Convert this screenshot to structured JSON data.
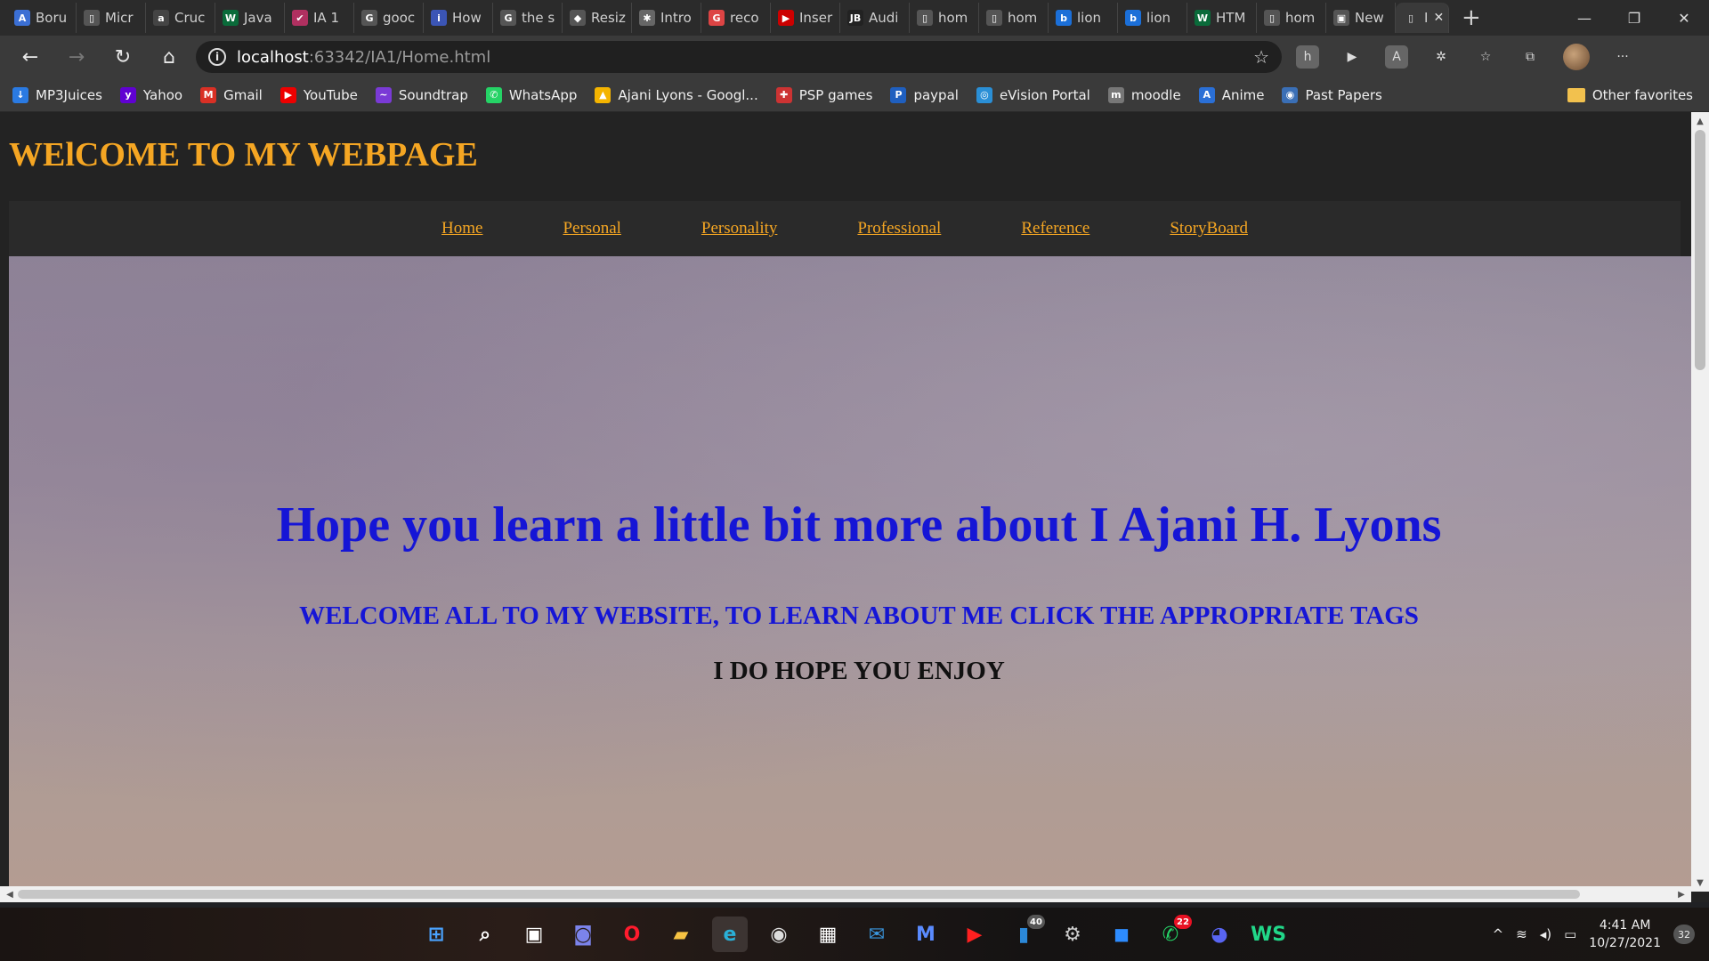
{
  "browser": {
    "tabs": [
      {
        "title": "Boru",
        "icon": "A",
        "icon_color": "#3b6fd4"
      },
      {
        "title": "Micr",
        "icon": "▯",
        "icon_color": "#555"
      },
      {
        "title": "Cruc",
        "icon": "a",
        "icon_color": "#444"
      },
      {
        "title": "Java",
        "icon": "W",
        "icon_color": "#0a6b3a"
      },
      {
        "title": "IA 1",
        "icon": "✔",
        "icon_color": "#b03060"
      },
      {
        "title": "gooc",
        "icon": "G",
        "icon_color": "#555"
      },
      {
        "title": "How",
        "icon": "i",
        "icon_color": "#3b55b5"
      },
      {
        "title": "the s",
        "icon": "G",
        "icon_color": "#555"
      },
      {
        "title": "Resiz",
        "icon": "◆",
        "icon_color": "#555"
      },
      {
        "title": "Intro",
        "icon": "✱",
        "icon_color": "#666"
      },
      {
        "title": "reco",
        "icon": "G",
        "icon_color": "#d44"
      },
      {
        "title": "Inser",
        "icon": "▶",
        "icon_color": "#c00"
      },
      {
        "title": "Audi",
        "icon": "JB",
        "icon_color": "#222"
      },
      {
        "title": "hom",
        "icon": "▯",
        "icon_color": "#555"
      },
      {
        "title": "hom",
        "icon": "▯",
        "icon_color": "#555"
      },
      {
        "title": "lion",
        "icon": "b",
        "icon_color": "#1b6fd8"
      },
      {
        "title": "lion",
        "icon": "b",
        "icon_color": "#1b6fd8"
      },
      {
        "title": "HTM",
        "icon": "W",
        "icon_color": "#0a6b3a"
      },
      {
        "title": "hom",
        "icon": "▯",
        "icon_color": "#555"
      },
      {
        "title": "New",
        "icon": "▣",
        "icon_color": "#555"
      }
    ],
    "active_tab": {
      "title": "I",
      "close": "✕"
    },
    "new_tab": "+",
    "window_controls": {
      "minimize": "—",
      "restore": "❐",
      "close": "✕"
    },
    "nav": {
      "back": "←",
      "forward": "→",
      "reload": "↻",
      "home": "⌂"
    },
    "url": {
      "host": "localhost",
      "path": ":63342/IA1/Home.html",
      "info": "i"
    },
    "toolbar_icons": {
      "favorite": "☆",
      "more": "···"
    },
    "favorites": [
      {
        "label": "MP3Juices",
        "icon": "↓",
        "color": "#2a7ae2"
      },
      {
        "label": "Yahoo",
        "icon": "y",
        "color": "#6001d2"
      },
      {
        "label": "Gmail",
        "icon": "M",
        "color": "#d93025"
      },
      {
        "label": "YouTube",
        "icon": "▶",
        "color": "#e00"
      },
      {
        "label": "Soundtrap",
        "icon": "~",
        "color": "#7a3ad6"
      },
      {
        "label": "WhatsApp",
        "icon": "✆",
        "color": "#25d366"
      },
      {
        "label": "Ajani Lyons - Googl...",
        "icon": "▲",
        "color": "#f4b400"
      },
      {
        "label": "PSP games",
        "icon": "✚",
        "color": "#c33"
      },
      {
        "label": "paypal",
        "icon": "P",
        "color": "#1f5fbf"
      },
      {
        "label": "eVision Portal",
        "icon": "◎",
        "color": "#2a8fd6"
      },
      {
        "label": "moodle",
        "icon": "m",
        "color": "#777"
      },
      {
        "label": "Anime",
        "icon": "A",
        "color": "#2a6fd6"
      },
      {
        "label": "Past Papers",
        "icon": "◉",
        "color": "#3a6fb6"
      }
    ],
    "favorites_more": "›",
    "other_favorites": "Other favorites"
  },
  "page": {
    "header": "WElCOME TO MY WEBPAGE",
    "nav_links": [
      "Home",
      "Personal",
      "Personality",
      "Professional",
      "Reference",
      "StoryBoard"
    ],
    "hero_title": "Hope you learn a little bit more about I Ajani H. Lyons",
    "hero_subtitle": "WELCOME ALL TO MY WEBSITE, TO LEARN ABOUT ME CLICK THE APPROPRIATE TAGS",
    "hero_tagline": "I DO HOPE YOU ENJOY"
  },
  "taskbar": {
    "apps": [
      {
        "name": "start",
        "icon": "⊞",
        "color": "#4aa3ff"
      },
      {
        "name": "search",
        "icon": "⌕",
        "color": "#fff"
      },
      {
        "name": "widgets",
        "icon": "▣",
        "color": "#fff"
      },
      {
        "name": "chat",
        "icon": "◙",
        "color": "#7b83eb"
      },
      {
        "name": "opera",
        "icon": "O",
        "color": "#ff1b2d"
      },
      {
        "name": "file-explorer",
        "icon": "▰",
        "color": "#f6c343"
      },
      {
        "name": "edge",
        "icon": "e",
        "color": "#2ab0d8"
      },
      {
        "name": "media",
        "icon": "◉",
        "color": "#ddd"
      },
      {
        "name": "store",
        "icon": "▦",
        "color": "#fff"
      },
      {
        "name": "mail",
        "icon": "✉",
        "color": "#3a96dd"
      },
      {
        "name": "visual-studio",
        "icon": "M",
        "color": "#5a8bff"
      },
      {
        "name": "youtube-music",
        "icon": "▶",
        "color": "#ff2020"
      },
      {
        "name": "files",
        "icon": "▮",
        "color": "#2b88d8",
        "badge": "40",
        "badge_color": "#555"
      },
      {
        "name": "settings",
        "icon": "⚙",
        "color": "#ccc"
      },
      {
        "name": "zoom",
        "icon": "◼",
        "color": "#2d8cff"
      },
      {
        "name": "whatsapp",
        "icon": "✆",
        "color": "#25d366",
        "badge": "22",
        "badge_color": "#e81123"
      },
      {
        "name": "discord",
        "icon": "◕",
        "color": "#5865f2"
      },
      {
        "name": "webstorm",
        "icon": "WS",
        "color": "#21d789"
      }
    ],
    "tray": {
      "chevron": "^",
      "wifi": "≋",
      "volume": "◂)",
      "battery": "▭",
      "time": "4:41 AM",
      "date": "10/27/2021",
      "notifications": "32"
    }
  }
}
